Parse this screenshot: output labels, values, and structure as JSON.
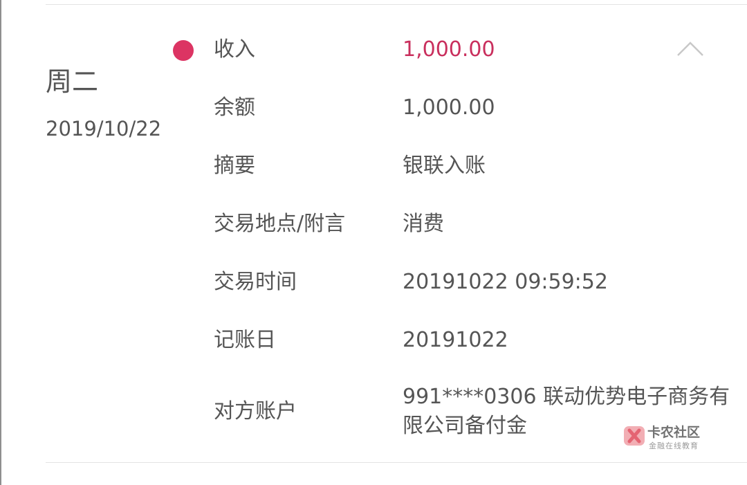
{
  "day": {
    "weekday": "周二",
    "date": "2019/10/22"
  },
  "details": [
    {
      "label": "收入",
      "value": "1,000.00"
    },
    {
      "label": "余额",
      "value": "1,000.00"
    },
    {
      "label": "摘要",
      "value": "银联入账"
    },
    {
      "label": "交易地点/附言",
      "value": "消费"
    },
    {
      "label": "交易时间",
      "value": "20191022 09:59:52"
    },
    {
      "label": "记账日",
      "value": "20191022"
    },
    {
      "label": "对方账户",
      "value": "991****0306 联动优势电子商务有限公司备付金"
    }
  ],
  "icons": {
    "transaction_indicator": "income-dot-icon",
    "collapse": "chevron-up-icon",
    "watermark_logo": "kanong-logo-icon"
  },
  "watermark": {
    "title": "卡农社区",
    "subtitle": "金融在线教育"
  },
  "colors": {
    "income_dot": "#dc3463",
    "income_amount": "#c92f5d",
    "text": "#555555",
    "divider": "#e3e3e3"
  }
}
